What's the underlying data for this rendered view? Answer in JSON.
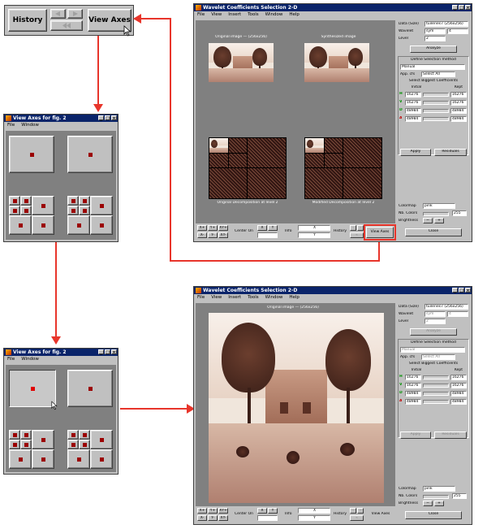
{
  "toolbar_crop": {
    "history_label": "History",
    "view_axes_label": "View Axes",
    "undo_icon": "arrow-left-icon",
    "redo_icon": "arrow-right-icon",
    "clear_icon": "double-arrow-icon"
  },
  "view_axes_win_top": {
    "title": "View Axes for fig. 2",
    "menu": [
      "File",
      "Window"
    ]
  },
  "view_axes_win_bottom": {
    "title": "View Axes for fig. 2",
    "menu": [
      "File",
      "Window"
    ]
  },
  "main_win_top": {
    "title": "Wavelet Coefficients Selection 2-D",
    "menu": [
      "File",
      "View",
      "Insert",
      "Tools",
      "Window",
      "Help"
    ],
    "panel_titles": [
      "Original image — (256x256)",
      "Synthesized image"
    ],
    "bottom_titles": [
      "Original Decomposition at level 2",
      "Modified Decomposition at level 2"
    ],
    "right": {
      "data_label": "Data (Size)",
      "data_value": "tuileries7 (256x256)",
      "wavelet_label": "Wavelet",
      "wavelet_value": "sym",
      "wavelet_num": "4",
      "level_label": "Level",
      "level_value": "2",
      "analyze": "Analyze",
      "define_title": "Define Selection method",
      "method_value": "Manual",
      "app_coef_label": "App. cfs",
      "app_coef_value": "Select All",
      "select_biggest": "Select Biggest Coefficients",
      "col_initial": "Initial",
      "col_kept": "Kept",
      "rows": [
        {
          "tag": "H",
          "initial": "16276",
          "kept": "16276"
        },
        {
          "tag": "V",
          "initial": "16276",
          "kept": "16276"
        },
        {
          "tag": "D",
          "initial": "48984",
          "kept": "48984"
        },
        {
          "tag": "A",
          "initial": "48984",
          "kept": "48984"
        }
      ],
      "apply": "Apply",
      "residuals": "Residuals",
      "colormap_label": "Colormap",
      "colormap_value": "pink",
      "nbcolors_label": "Nb. Colors",
      "nbcolors_value": "255",
      "brightness_label": "Brightness",
      "close": "Close"
    },
    "bottom": {
      "xy_labels": [
        "X+",
        "Y+",
        "XY+",
        "X-",
        "Y-",
        "XY-"
      ],
      "center_on": "Center On",
      "info": "Info",
      "history": "History",
      "view_axes": "View Axes"
    }
  },
  "main_win_bottom": {
    "title": "Wavelet Coefficients Selection 2-D",
    "menu": [
      "File",
      "View",
      "Insert",
      "Tools",
      "Window",
      "Help"
    ],
    "panel_title": "Original image — (256x256)",
    "right": {
      "data_label": "Data (Size)",
      "data_value": "tuileries7 (256x256)",
      "wavelet_label": "Wavelet",
      "wavelet_value": "sym",
      "wavelet_num": "4",
      "level_label": "Level",
      "level_value": "2",
      "analyze": "Analyze",
      "define_title": "Define Selection method",
      "method_value": "Manual",
      "app_coef_label": "App. cfs",
      "app_coef_value": "Select All",
      "select_biggest": "Select Biggest Coefficients",
      "col_initial": "Initial",
      "col_kept": "Kept",
      "rows": [
        {
          "tag": "H",
          "initial": "16276",
          "kept": "16276"
        },
        {
          "tag": "V",
          "initial": "16276",
          "kept": "16276"
        },
        {
          "tag": "D",
          "initial": "48984",
          "kept": "48984"
        },
        {
          "tag": "A",
          "initial": "48984",
          "kept": "48984"
        }
      ],
      "apply": "Apply",
      "residuals": "Residuals",
      "colormap_label": "Colormap",
      "colormap_value": "pink",
      "nbcolors_label": "Nb. Colors",
      "nbcolors_value": "255",
      "brightness_label": "Brightness",
      "close": "Close"
    },
    "bottom": {
      "xy_labels": [
        "X+",
        "Y+",
        "XY+",
        "X-",
        "Y-",
        "XY-"
      ],
      "center_on": "Center On",
      "info": "Info",
      "history": "History",
      "view_axes": "View Axes"
    }
  },
  "colors": {
    "arrow": "#e8352b",
    "titlebar": "#0a246a",
    "face": "#c0c0c0",
    "marker": "#9b0000"
  }
}
